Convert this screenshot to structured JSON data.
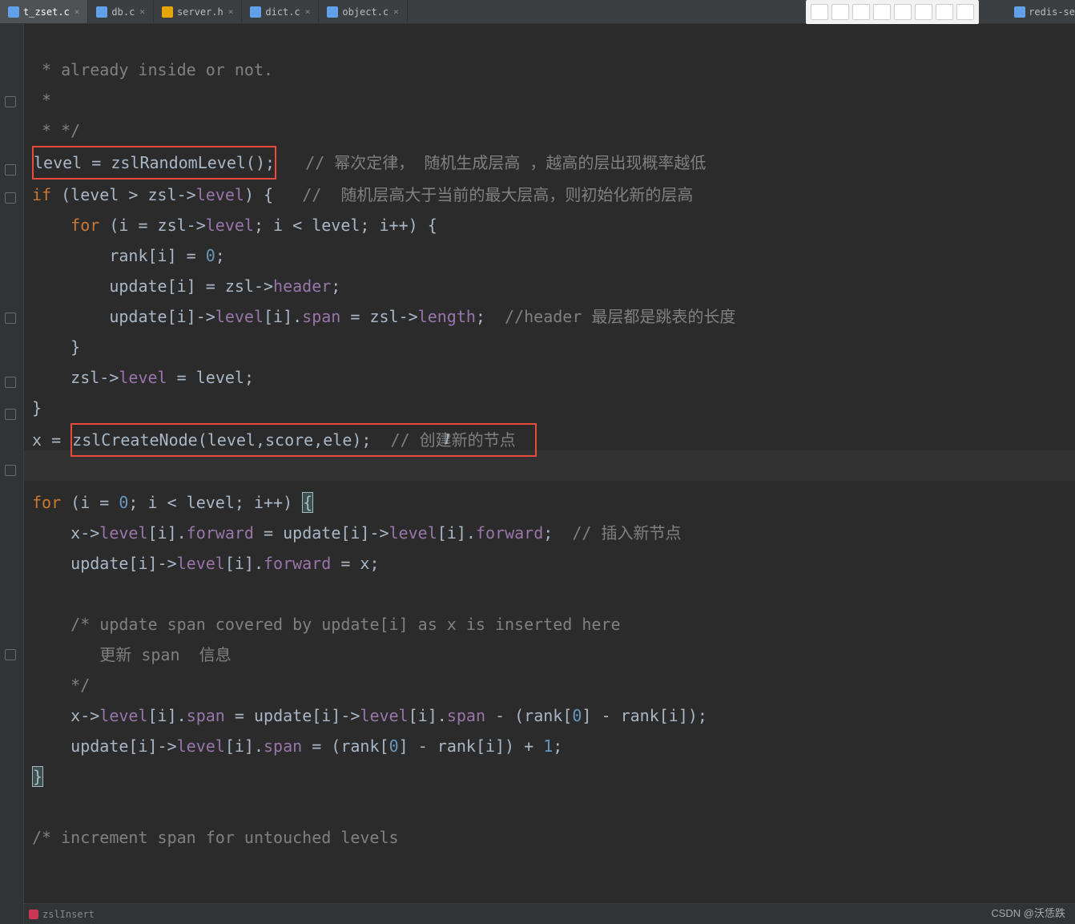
{
  "tabs": [
    {
      "name": "t_zset.c",
      "active": true
    },
    {
      "name": "db.c",
      "active": false
    },
    {
      "name": "server.h",
      "active": false
    },
    {
      "name": "dict.c",
      "active": false
    },
    {
      "name": "object.c",
      "active": false
    }
  ],
  "right_panel": "redis-se",
  "breadcrumb": "zslInsert",
  "watermark": "CSDN @沃恁跌",
  "code": {
    "l1": " * already inside or not.",
    "l2": " *",
    "l3": " * */",
    "l4_a": "level = zslRandomLevel();",
    "l4_cmt": "// 幂次定律， 随机生成层高 ，越高的层出现概率越低",
    "l5_if": "if",
    "l5_cond": " (level > zsl->",
    "l5_level": "level",
    "l5_rest": ") {   ",
    "l5_cmt": "//  随机层高大于当前的最大层高，则初始化新的层高",
    "l6_for": "for",
    "l6_a": " (i = zsl->",
    "l6_level": "level",
    "l6_b": "; i < level; i++) {",
    "l7_a": "rank[i] = ",
    "l7_0": "0",
    "l7_b": ";",
    "l8_a": "update[i] = zsl->",
    "l8_h": "header",
    "l8_b": ";",
    "l9_a": "update[i]->",
    "l9_lvl": "level",
    "l9_b": "[i].",
    "l9_span": "span",
    "l9_c": " = zsl->",
    "l9_len": "length",
    "l9_d": ";  ",
    "l9_cmt": "//header 最层都是跳表的长度",
    "l10": "}",
    "l11_a": "zsl->",
    "l11_lvl": "level",
    "l11_b": " = level;",
    "l12": "}",
    "l13_a": "x = ",
    "l13_box": "zslCreateNode(level,score,ele);  ",
    "l13_cmt": "// 创建新的节点",
    "l14": "",
    "l15_for": "for",
    "l15_a": " (i = ",
    "l15_0": "0",
    "l15_b": "; i < level; i++) ",
    "l15_brace": "{",
    "l16_a": "x->",
    "l16_lvl": "level",
    "l16_b": "[i].",
    "l16_fwd": "forward",
    "l16_c": " = update[i]->",
    "l16_lvl2": "level",
    "l16_d": "[i].",
    "l16_fwd2": "forward",
    "l16_e": ";  ",
    "l16_cmt": "// 插入新节点",
    "l17_a": "update[i]->",
    "l17_lvl": "level",
    "l17_b": "[i].",
    "l17_fwd": "forward",
    "l17_c": " = x;",
    "l18": "",
    "l19_cmt": "/* update span covered by update[i] as x is inserted here",
    "l20_cmt": "   更新 span  信息",
    "l21_cmt": "*/",
    "l22_a": "x->",
    "l22_lvl": "level",
    "l22_b": "[i].",
    "l22_span": "span",
    "l22_c": " = update[i]->",
    "l22_lvl2": "level",
    "l22_d": "[i].",
    "l22_span2": "span",
    "l22_e": " - (rank[",
    "l22_0": "0",
    "l22_f": "] - rank[i]);",
    "l23_a": "update[i]->",
    "l23_lvl": "level",
    "l23_b": "[i].",
    "l23_span": "span",
    "l23_c": " = (rank[",
    "l23_0": "0",
    "l23_d": "] - rank[i]) + ",
    "l23_1": "1",
    "l23_e": ";",
    "l24": "}",
    "l25": "",
    "l26_cmt": "/* increment span for untouched levels"
  }
}
